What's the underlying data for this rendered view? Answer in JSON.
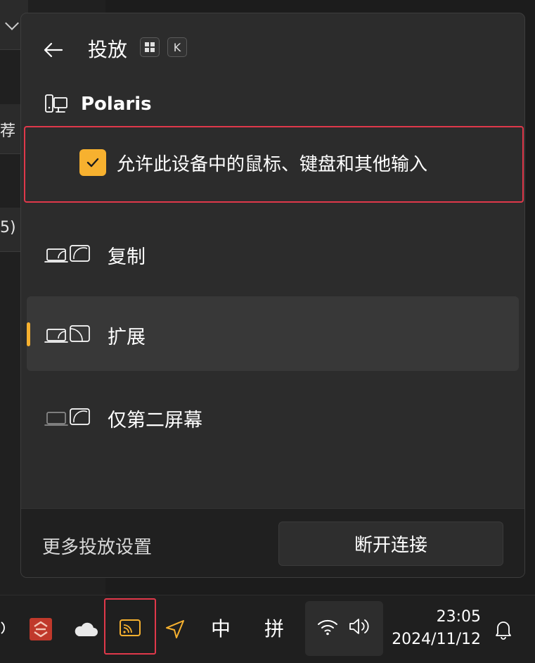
{
  "background_app": {
    "text_fragments": [
      "荐",
      "5)"
    ]
  },
  "cast_panel": {
    "title": "投放",
    "shortcut_keys": [
      "⊞",
      "K"
    ],
    "device_name": "Polaris",
    "allow_input_checkbox": {
      "label": "允许此设备中的鼠标、键盘和其他输入",
      "checked": true
    },
    "modes": [
      {
        "label": "复制",
        "icon": "duplicate-mode-icon",
        "selected": false
      },
      {
        "label": "扩展",
        "icon": "extend-mode-icon",
        "selected": true
      },
      {
        "label": "仅第二屏幕",
        "icon": "second-screen-only-icon",
        "selected": false
      }
    ],
    "footer": {
      "more_settings_label": "更多投放设置",
      "disconnect_label": "断开连接"
    },
    "accent_color": "#f7b12f"
  },
  "taskbar": {
    "items": [
      {
        "name": "app-icon-red",
        "icon": "red-app-icon"
      },
      {
        "name": "onedrive",
        "icon": "cloud-icon"
      },
      {
        "name": "cast",
        "icon": "cast-icon",
        "color": "#f7b12f"
      },
      {
        "name": "location",
        "icon": "location-arrow-icon",
        "color": "#f7b12f"
      }
    ],
    "ime_mode": "中",
    "ime_name": "拼",
    "time": "23:05",
    "date": "2024/11/12"
  }
}
